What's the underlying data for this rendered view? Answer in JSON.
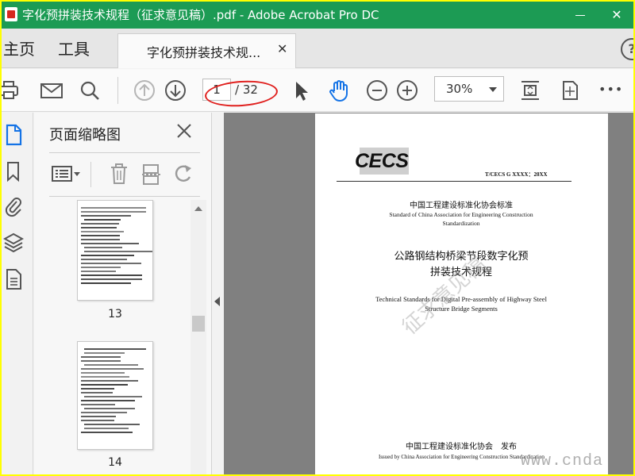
{
  "window": {
    "title": "字化预拼装技术规程（征求意见稿）.pdf - Adobe Acrobat Pro DC",
    "minimize_label": "",
    "close_label": "✕"
  },
  "tabs": {
    "home": "主页",
    "tools": "工具",
    "document": "字化预拼装技术规...",
    "document_close": "✕",
    "help": "?"
  },
  "toolbar": {
    "page_current": "1",
    "page_total": "/ 32",
    "zoom": "30%",
    "more": "•••"
  },
  "panel": {
    "title": "页面缩略图",
    "thumbnails": [
      {
        "page": "13"
      },
      {
        "page": "14"
      }
    ]
  },
  "document": {
    "logo": "CECS",
    "standard_code": "T/CECS G XXXX：20XX",
    "org_cn": "中国工程建设标准化协会标准",
    "org_en_1": "Standard of China Association for Engineering Construction",
    "org_en_2": "Standardization",
    "title_cn_1": "公路钢结构桥梁节段数字化预",
    "title_cn_2": "拼装技术规程",
    "title_en_1": "Technical Standards for Digital Pre-assembly of Highway Steel",
    "title_en_2": "Structure Bridge Segments",
    "watermark": "征求意见稿",
    "issuer_cn": "中国工程建设标准化协会　发布",
    "issuer_en": "Issued by China Association for Engineering Construction Standardization"
  },
  "site_watermark": "www.cnda",
  "colors": {
    "titlebar": "#1c9b54",
    "accent_blue": "#1473e6",
    "annotation_red": "#e0201e"
  }
}
